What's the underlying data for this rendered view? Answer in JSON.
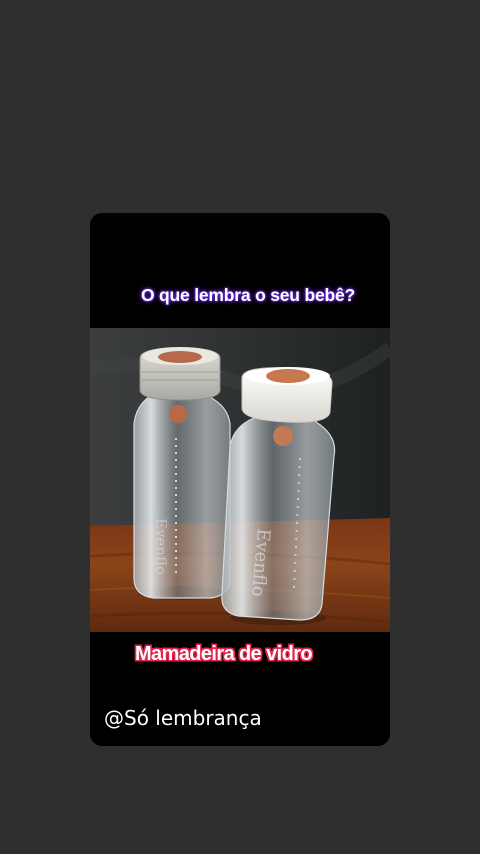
{
  "colors": {
    "page_background": "#302f2f",
    "card_background": "#000000",
    "headline_glow": "#6a2bd9",
    "caption_outline": "#e0254f"
  },
  "story": {
    "headline": "O que lembra o seu bebê?",
    "caption": "Mamadeira de vidro",
    "handle": "@Só lembrança"
  }
}
